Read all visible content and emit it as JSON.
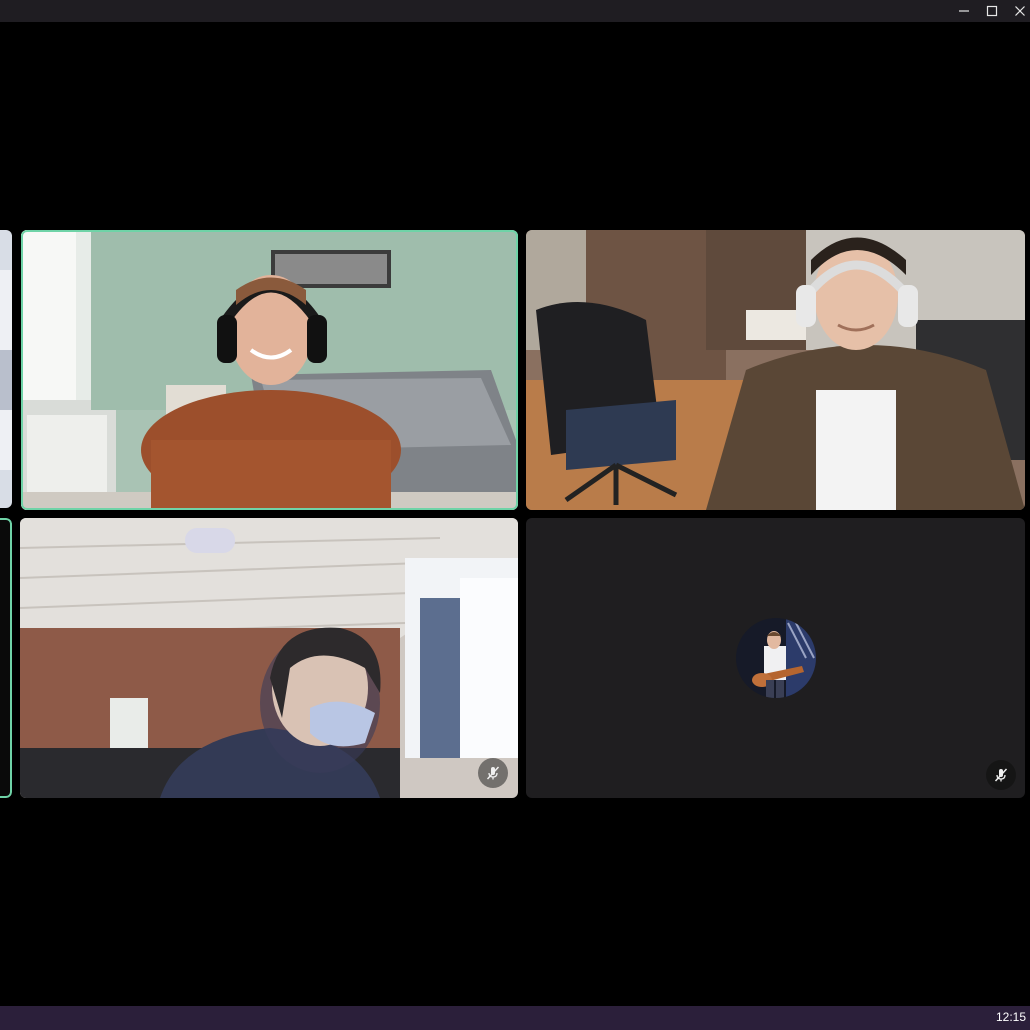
{
  "window": {
    "minimize_icon": "minimize-icon",
    "maximize_icon": "maximize-icon",
    "close_icon": "close-icon"
  },
  "participants": [
    {
      "tile": "left-edge-partial-top",
      "video": true
    },
    {
      "tile": "bedroom-headset-participant",
      "video": true,
      "active_speaker": true
    },
    {
      "tile": "office-headset-participant",
      "video": true
    },
    {
      "tile": "left-edge-partial-bottom",
      "video": true,
      "active_speaker": true
    },
    {
      "tile": "classroom-masked-participant",
      "video": true,
      "muted": true
    },
    {
      "tile": "avatar-guitarist-participant",
      "video": false,
      "muted": true
    }
  ],
  "icons": {
    "mute": "microphone-off-icon",
    "avatar": "profile-avatar"
  },
  "colors": {
    "active_speaker_border": "#6fd3a7",
    "stage_background": "#000000",
    "empty_tile": "#1f1e20",
    "taskbar": "#2b1f3a"
  },
  "taskbar": {
    "clock": "12:15"
  }
}
